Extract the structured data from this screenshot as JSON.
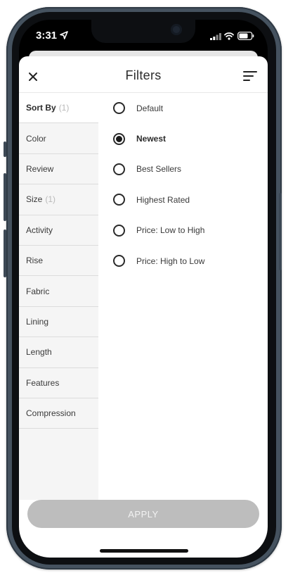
{
  "status_bar": {
    "time": "3:31",
    "icons": [
      "location-arrow-icon",
      "cellular-signal-icon",
      "wifi-icon",
      "battery-icon"
    ]
  },
  "header": {
    "title": "Filters",
    "close_icon": "close-icon",
    "sort_icon": "sort-lines-icon"
  },
  "sidebar": {
    "items": [
      {
        "label": "Sort By",
        "count": "(1)",
        "active": true
      },
      {
        "label": "Color",
        "count": ""
      },
      {
        "label": "Review",
        "count": ""
      },
      {
        "label": "Size",
        "count": "(1)"
      },
      {
        "label": "Activity",
        "count": ""
      },
      {
        "label": "Rise",
        "count": ""
      },
      {
        "label": "Fabric",
        "count": ""
      },
      {
        "label": "Lining",
        "count": ""
      },
      {
        "label": "Length",
        "count": ""
      },
      {
        "label": "Features",
        "count": ""
      },
      {
        "label": "Compression",
        "count": ""
      }
    ]
  },
  "sort_options": {
    "items": [
      {
        "label": "Default",
        "selected": false
      },
      {
        "label": "Newest",
        "selected": true
      },
      {
        "label": "Best Sellers",
        "selected": false
      },
      {
        "label": "Highest Rated",
        "selected": false
      },
      {
        "label": "Price: Low to High",
        "selected": false
      },
      {
        "label": "Price: High to Low",
        "selected": false
      }
    ]
  },
  "footer": {
    "apply_label": "APPLY",
    "apply_color": "#bdbdbd"
  },
  "colors": {
    "frame": "#45525f",
    "sidebar_bg": "#f5f5f5",
    "text": "#2b2b2b",
    "muted": "#b9b9b9"
  }
}
